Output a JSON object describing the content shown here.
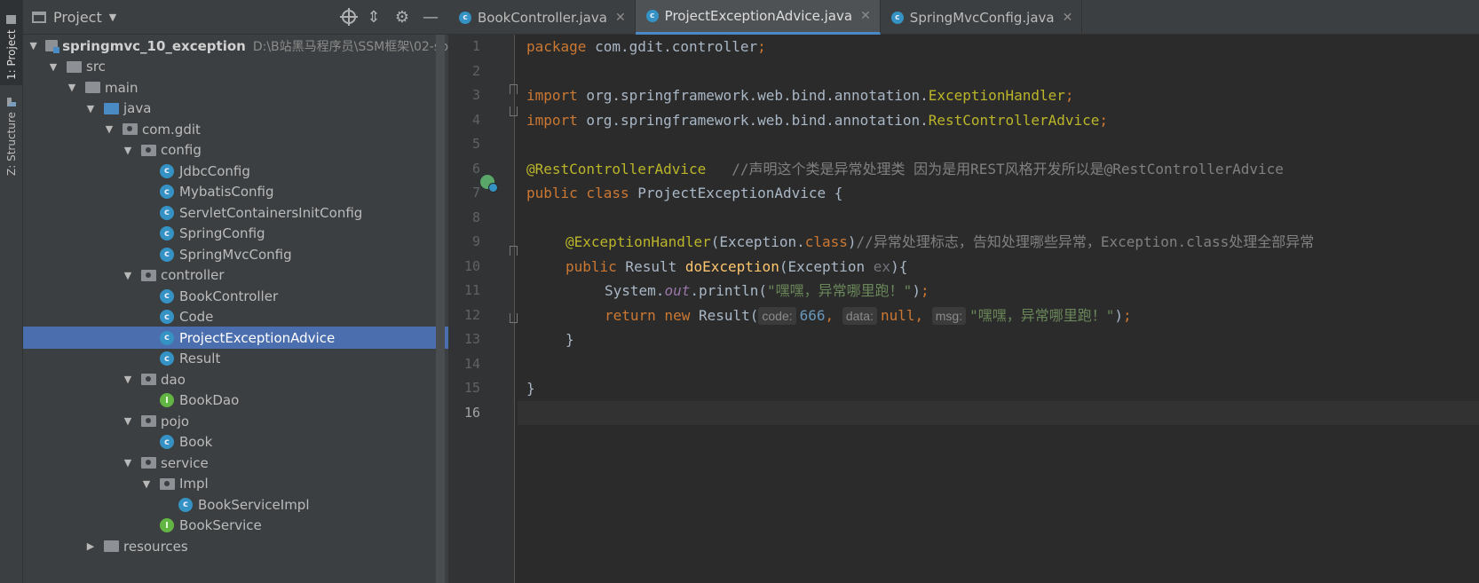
{
  "toolstrip": {
    "project_tab": "1: Project",
    "structure_tab": "Z: Structure"
  },
  "project_panel": {
    "title": "Project",
    "root": {
      "name": "springmvc_10_exception",
      "path": "D:\\B站黑马程序员\\SSM框架\\02-sp"
    },
    "tree": [
      {
        "label": "src",
        "depth": 1,
        "expanded": true,
        "icon": "folder-icon"
      },
      {
        "label": "main",
        "depth": 2,
        "expanded": true,
        "icon": "folder-icon"
      },
      {
        "label": "java",
        "depth": 3,
        "expanded": true,
        "icon": "source-folder-icon"
      },
      {
        "label": "com.gdit",
        "depth": 4,
        "expanded": true,
        "icon": "package-icon"
      },
      {
        "label": "config",
        "depth": 5,
        "expanded": true,
        "icon": "package-icon"
      },
      {
        "label": "JdbcConfig",
        "depth": 6,
        "icon": "class-icon"
      },
      {
        "label": "MybatisConfig",
        "depth": 6,
        "icon": "class-icon"
      },
      {
        "label": "ServletContainersInitConfig",
        "depth": 6,
        "icon": "class-icon"
      },
      {
        "label": "SpringConfig",
        "depth": 6,
        "icon": "class-icon"
      },
      {
        "label": "SpringMvcConfig",
        "depth": 6,
        "icon": "class-icon"
      },
      {
        "label": "controller",
        "depth": 5,
        "expanded": true,
        "icon": "package-icon"
      },
      {
        "label": "BookController",
        "depth": 6,
        "icon": "class-icon"
      },
      {
        "label": "Code",
        "depth": 6,
        "icon": "class-icon"
      },
      {
        "label": "ProjectExceptionAdvice",
        "depth": 6,
        "icon": "class-icon",
        "selected": true
      },
      {
        "label": "Result",
        "depth": 6,
        "icon": "class-icon"
      },
      {
        "label": "dao",
        "depth": 5,
        "expanded": true,
        "icon": "package-icon"
      },
      {
        "label": "BookDao",
        "depth": 6,
        "icon": "interface-icon"
      },
      {
        "label": "pojo",
        "depth": 5,
        "expanded": true,
        "icon": "package-icon"
      },
      {
        "label": "Book",
        "depth": 6,
        "icon": "class-icon"
      },
      {
        "label": "service",
        "depth": 5,
        "expanded": true,
        "icon": "package-icon"
      },
      {
        "label": "Impl",
        "depth": 6,
        "expanded": true,
        "icon": "package-icon"
      },
      {
        "label": "BookServiceImpl",
        "depth": 7,
        "icon": "class-icon"
      },
      {
        "label": "BookService",
        "depth": 6,
        "icon": "interface-icon"
      },
      {
        "label": "resources",
        "depth": 3,
        "expanded": false,
        "icon": "resources-folder-icon"
      }
    ]
  },
  "editor": {
    "tabs": [
      {
        "label": "BookController.java",
        "active": false
      },
      {
        "label": "ProjectExceptionAdvice.java",
        "active": true
      },
      {
        "label": "SpringMvcConfig.java",
        "active": false
      }
    ],
    "line_numbers": [
      "1",
      "2",
      "3",
      "4",
      "5",
      "6",
      "7",
      "8",
      "9",
      "10",
      "11",
      "12",
      "13",
      "14",
      "15",
      "16"
    ],
    "current_line": 16,
    "code": {
      "l1_kw": "package",
      "l1_pkg": " com.gdit.controller",
      "l1_semi": ";",
      "l3_kw": "import",
      "l3_path": " org.springframework.web.bind.annotation.",
      "l3_cls": "ExceptionHandler",
      "l3_semi": ";",
      "l4_kw": "import",
      "l4_path": " org.springframework.web.bind.annotation.",
      "l4_cls": "RestControllerAdvice",
      "l4_semi": ";",
      "l6_ann": "@RestControllerAdvice",
      "l6_cmt": "   //声明这个类是异常处理类 因为是用REST风格开发所以是@RestControllerAdvice",
      "l7_kw": "public class",
      "l7_rest": " ProjectExceptionAdvice {",
      "l9_ann": "@ExceptionHandler",
      "l9_a": "(Exception.",
      "l9_kw": "class",
      "l9_b": ")",
      "l9_cmt": "//异常处理标志，告知处理哪些异常，Exception.class处理全部异常",
      "l10_kw": "public",
      "l10_a": " Result ",
      "l10_fn": "doException",
      "l10_b": "(Exception ",
      "l10_param": "ex",
      "l10_c": "){",
      "l11_a": "System.",
      "l11_static": "out",
      "l11_b": ".println(",
      "l11_str": "\"嘿嘿，异常哪里跑！\"",
      "l11_c": ")",
      "l11_semi": ";",
      "l12_kw": "return new",
      "l12_a": " Result(",
      "l12_hint_code": "code:",
      "l12_num": "666",
      "l12_comma1": ", ",
      "l12_hint_data": "data:",
      "l12_null": "null",
      "l12_comma2": ", ",
      "l12_hint_msg": "msg:",
      "l12_str": "\"嘿嘿，异常哪里跑！\"",
      "l12_b": ")",
      "l12_semi": ";",
      "l13": "}",
      "l15": "}"
    }
  }
}
